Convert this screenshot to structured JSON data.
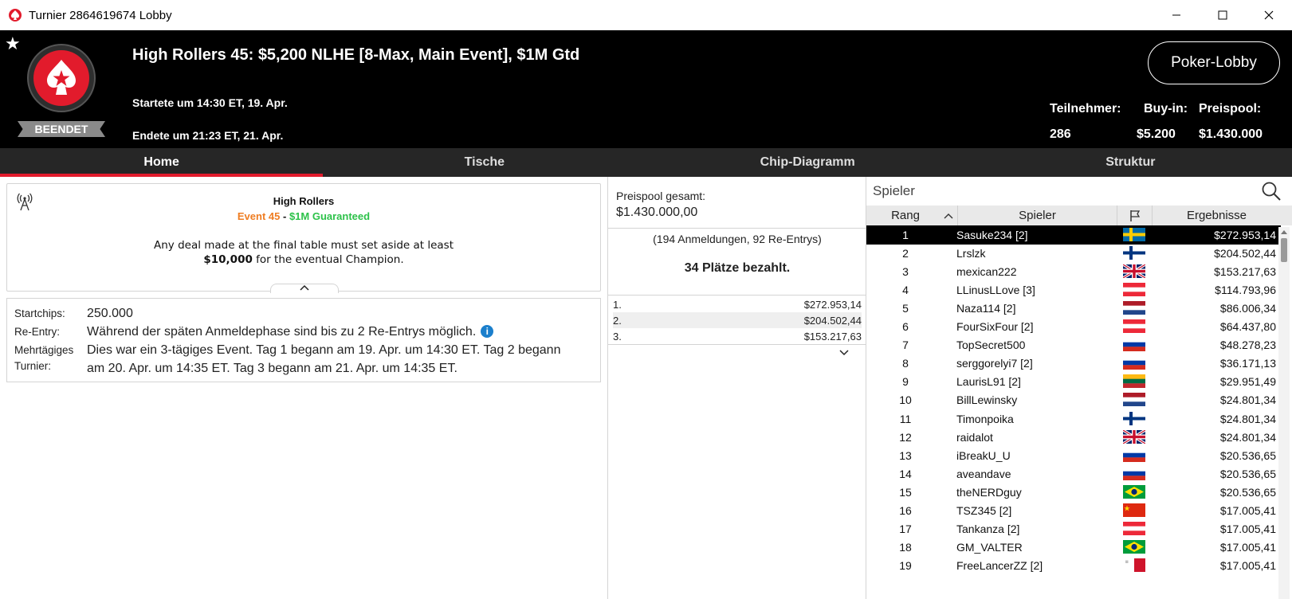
{
  "window": {
    "title": "Turnier 2864619674 Lobby"
  },
  "header": {
    "status": "BEENDET",
    "title": "High Rollers 45: $5,200 NLHE [8-Max, Main Event], $1M Gtd",
    "started": "Startete um 14:30 ET, 19. Apr.",
    "ended": "Endete um 21:23 ET, 21. Apr.",
    "lobby_button": "Poker-Lobby",
    "stats": {
      "players_label": "Teilnehmer:",
      "players_value": "286",
      "buyin_label": "Buy-in:",
      "buyin_value": "$5.200",
      "prizepool_label": "Preispool:",
      "prizepool_value": "$1.430.000"
    }
  },
  "tabs": [
    {
      "label": "Home",
      "active": true
    },
    {
      "label": "Tische",
      "active": false
    },
    {
      "label": "Chip-Diagramm",
      "active": false
    },
    {
      "label": "Struktur",
      "active": false
    }
  ],
  "info": {
    "title": "High Rollers",
    "event": "Event 45",
    "dash": " - ",
    "guarantee": "$1M Guaranteed",
    "deal_line1": "Any deal made at the final table must set aside at least",
    "deal_amount": "$10,000",
    "deal_line2": " for the eventual Champion."
  },
  "details": {
    "startchips_label": "Startchips:",
    "startchips_value": "250.000",
    "reentry_label": "Re-Entry:",
    "reentry_value": "Während der späten Anmeldephase sind bis zu 2 Re-Entrys möglich.",
    "multiday_label_1": "Mehrtägiges",
    "multiday_label_2": "Turnier:",
    "multiday_value_1": "Dies war ein 3-tägiges Event. Tag 1 begann am 19. Apr. um 14:30 ET. Tag 2 begann",
    "multiday_value_2": "am 20. Apr. um 14:35 ET. Tag 3 begann am 21. Apr. um 14:35 ET."
  },
  "prizepool": {
    "label": "Preispool gesamt:",
    "total": "$1.430.000,00",
    "entries": "(194 Anmeldungen, 92 Re-Entrys)",
    "paid": "34 Plätze bezahlt.",
    "payouts": [
      {
        "place": "1.",
        "amount": "$272.953,14"
      },
      {
        "place": "2.",
        "amount": "$204.502,44"
      },
      {
        "place": "3.",
        "amount": "$153.217,63"
      }
    ]
  },
  "players": {
    "search_placeholder": "Spieler",
    "col_rank": "Rang",
    "col_player": "Spieler",
    "col_results": "Ergebnisse",
    "rows": [
      {
        "rank": "1",
        "name": "Sasuke234 [2]",
        "flag": "se",
        "result": "$272.953,14"
      },
      {
        "rank": "2",
        "name": "Lrslzk",
        "flag": "fi",
        "result": "$204.502,44"
      },
      {
        "rank": "3",
        "name": "mexican222",
        "flag": "gb",
        "result": "$153.217,63"
      },
      {
        "rank": "4",
        "name": "LLinusLLove [3]",
        "flag": "at",
        "result": "$114.793,96"
      },
      {
        "rank": "5",
        "name": "Naza114 [2]",
        "flag": "nl",
        "result": "$86.006,34"
      },
      {
        "rank": "6",
        "name": "FourSixFour [2]",
        "flag": "at",
        "result": "$64.437,80"
      },
      {
        "rank": "7",
        "name": "TopSecret500",
        "flag": "ru",
        "result": "$48.278,23"
      },
      {
        "rank": "8",
        "name": "serggorelyi7 [2]",
        "flag": "ru",
        "result": "$36.171,13"
      },
      {
        "rank": "9",
        "name": "LaurisL91 [2]",
        "flag": "lt",
        "result": "$29.951,49"
      },
      {
        "rank": "10",
        "name": "BillLewinsky",
        "flag": "nl",
        "result": "$24.801,34"
      },
      {
        "rank": "11",
        "name": "Timonpoika",
        "flag": "fi",
        "result": "$24.801,34"
      },
      {
        "rank": "12",
        "name": "raidalot",
        "flag": "gb",
        "result": "$24.801,34"
      },
      {
        "rank": "13",
        "name": "iBreakU_U",
        "flag": "ru",
        "result": "$20.536,65"
      },
      {
        "rank": "14",
        "name": "aveandave",
        "flag": "ru",
        "result": "$20.536,65"
      },
      {
        "rank": "15",
        "name": "theNERDguy",
        "flag": "br",
        "result": "$20.536,65"
      },
      {
        "rank": "16",
        "name": "TSZ345 [2]",
        "flag": "cn",
        "result": "$17.005,41"
      },
      {
        "rank": "17",
        "name": "Tankanza [2]",
        "flag": "at",
        "result": "$17.005,41"
      },
      {
        "rank": "18",
        "name": "GM_VALTER",
        "flag": "br",
        "result": "$17.005,41"
      },
      {
        "rank": "19",
        "name": "FreeLancerZZ [2]",
        "flag": "mt",
        "result": "$17.005,41"
      }
    ]
  },
  "colors": {
    "brand_red": "#e21b2c",
    "event_orange": "#ef7d22",
    "guarantee_green": "#2dc24a"
  }
}
